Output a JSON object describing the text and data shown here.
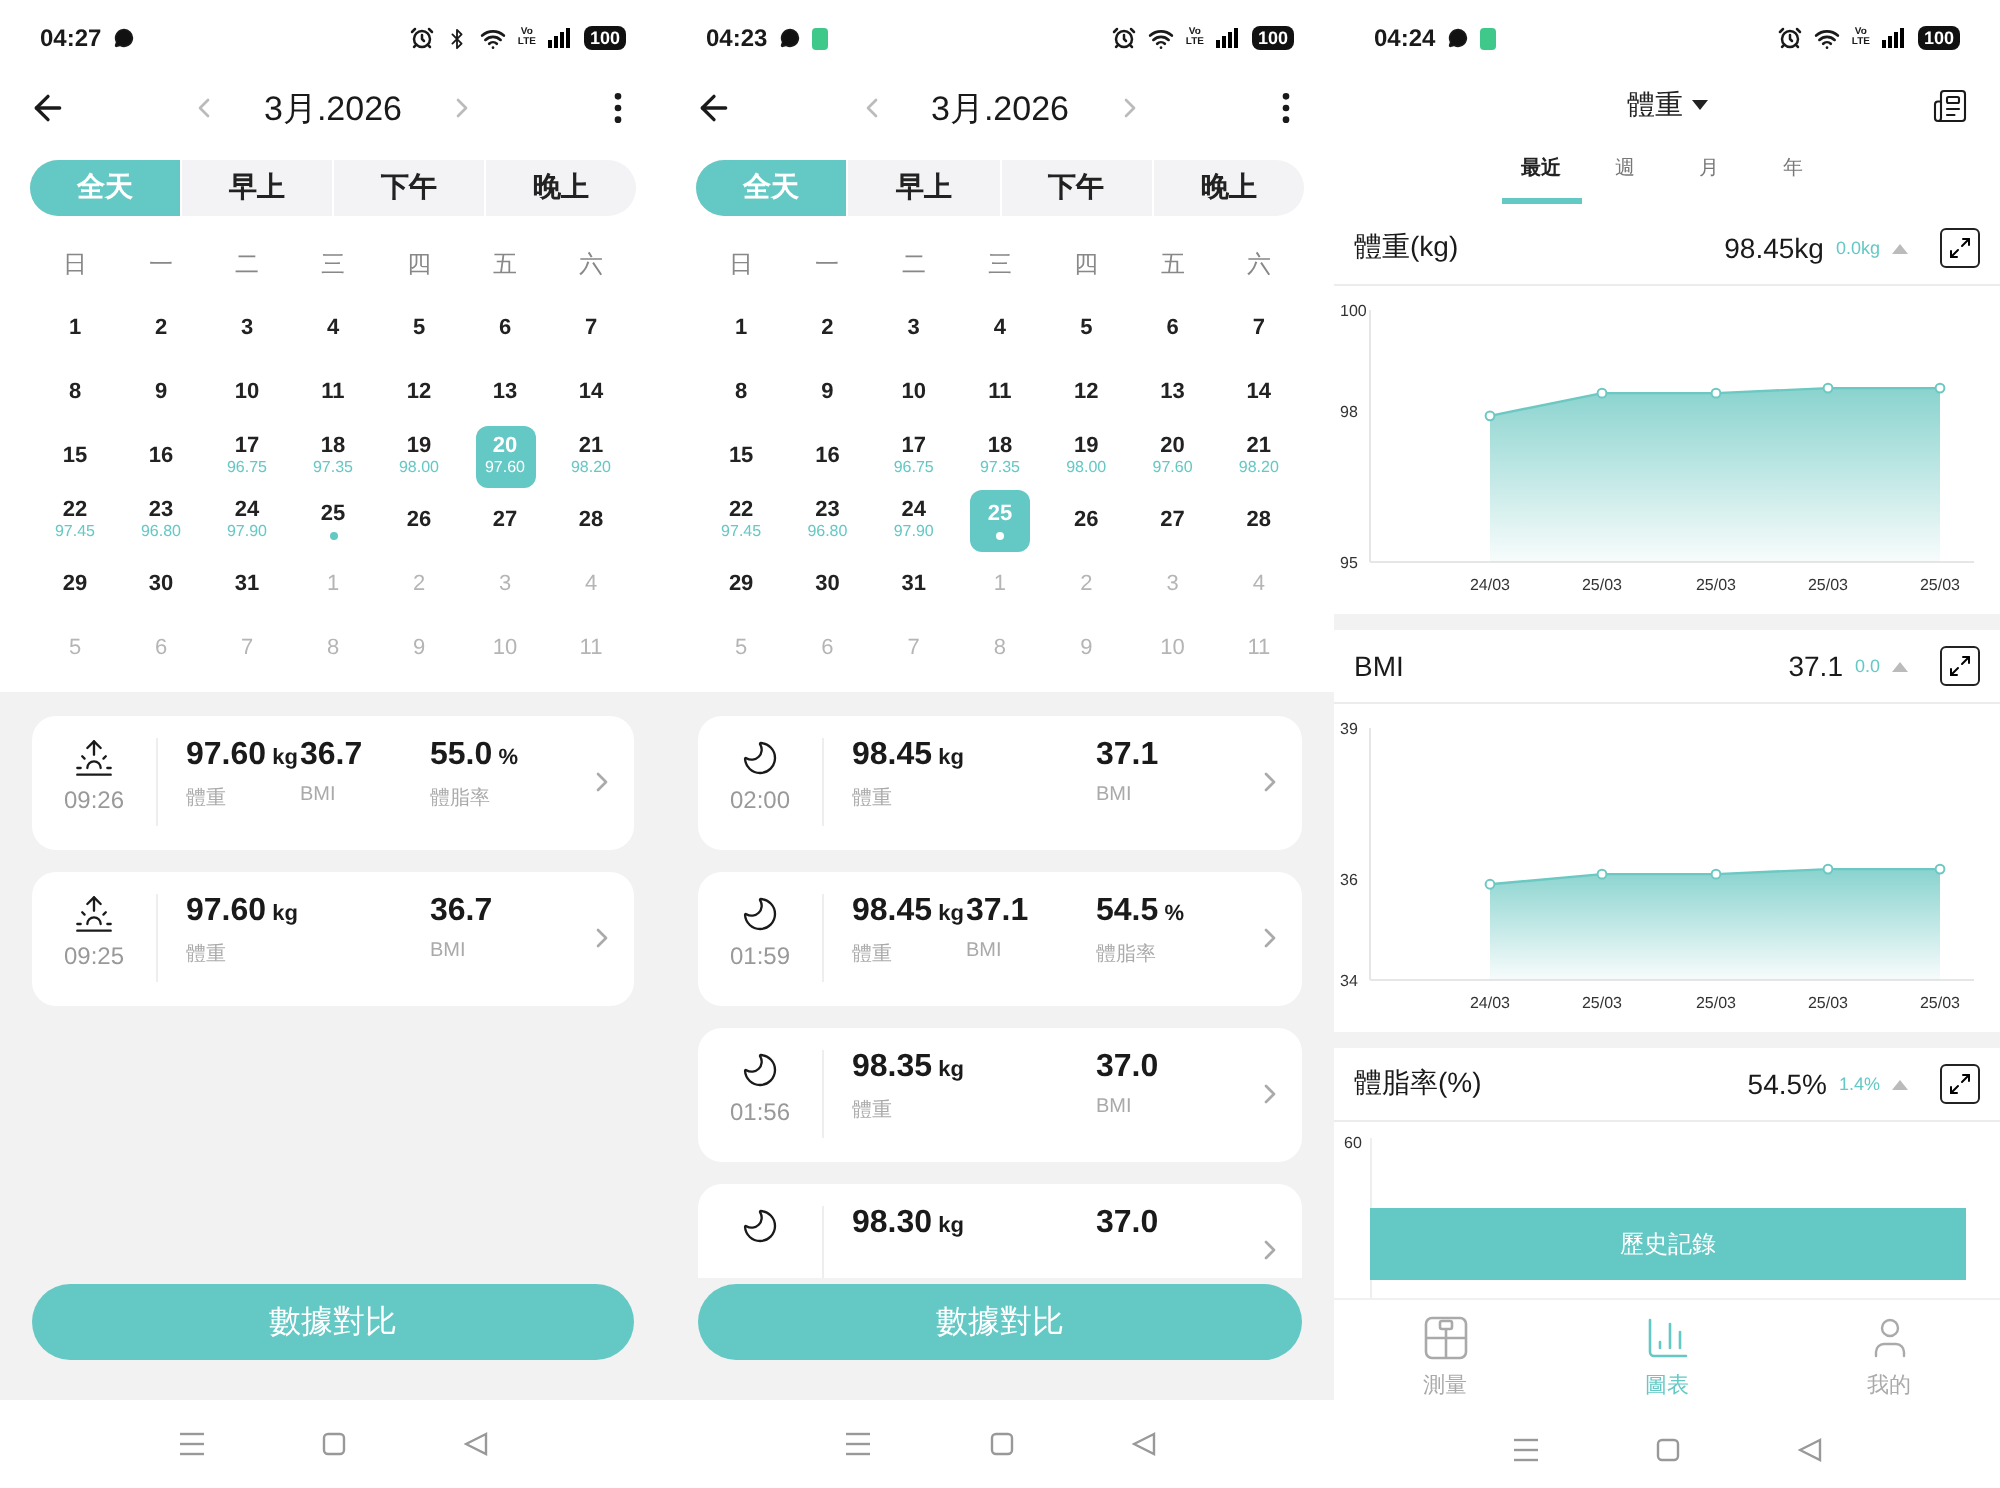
{
  "screens": [
    {
      "kind": "calendar",
      "status_bar": {
        "time": "04:27",
        "battery": "100",
        "left_icons": [
          {
            "kind": "chat"
          }
        ],
        "right_icons": [
          {
            "kind": "alarm"
          },
          {
            "kind": "bluetooth"
          },
          {
            "kind": "wifi"
          }
        ],
        "network": [
          "Vo",
          "LTE"
        ]
      },
      "month": "3月.2026",
      "segments": [
        {
          "label": "全天",
          "selected": true
        },
        {
          "label": "早上",
          "selected": false
        },
        {
          "label": "下午",
          "selected": false
        },
        {
          "label": "晚上",
          "selected": false
        }
      ],
      "weekdays": [
        "日",
        "一",
        "二",
        "三",
        "四",
        "五",
        "六"
      ],
      "weeks": [
        [
          {
            "day": "1",
            "muted": false,
            "selected": false,
            "dot": false
          },
          {
            "day": "2",
            "muted": false,
            "selected": false,
            "dot": false
          },
          {
            "day": "3",
            "muted": false,
            "selected": false,
            "dot": false
          },
          {
            "day": "4",
            "muted": false,
            "selected": false,
            "dot": false
          },
          {
            "day": "5",
            "muted": false,
            "selected": false,
            "dot": false
          },
          {
            "day": "6",
            "muted": false,
            "selected": false,
            "dot": false
          },
          {
            "day": "7",
            "muted": false,
            "selected": false,
            "dot": false
          }
        ],
        [
          {
            "day": "8",
            "muted": false,
            "selected": false,
            "dot": false
          },
          {
            "day": "9",
            "muted": false,
            "selected": false,
            "dot": false
          },
          {
            "day": "10",
            "muted": false,
            "selected": false,
            "dot": false
          },
          {
            "day": "11",
            "muted": false,
            "selected": false,
            "dot": false
          },
          {
            "day": "12",
            "muted": false,
            "selected": false,
            "dot": false
          },
          {
            "day": "13",
            "muted": false,
            "selected": false,
            "dot": false
          },
          {
            "day": "14",
            "muted": false,
            "selected": false,
            "dot": false
          }
        ],
        [
          {
            "day": "15",
            "muted": false,
            "selected": false,
            "dot": false
          },
          {
            "day": "16",
            "muted": false,
            "selected": false,
            "dot": false
          },
          {
            "day": "17",
            "reading": "96.75",
            "muted": false,
            "selected": false,
            "dot": false
          },
          {
            "day": "18",
            "reading": "97.35",
            "muted": false,
            "selected": false,
            "dot": false
          },
          {
            "day": "19",
            "reading": "98.00",
            "muted": false,
            "selected": false,
            "dot": false
          },
          {
            "day": "20",
            "reading": "97.60",
            "muted": false,
            "selected": true,
            "dot": false
          },
          {
            "day": "21",
            "reading": "98.20",
            "muted": false,
            "selected": false,
            "dot": false
          }
        ],
        [
          {
            "day": "22",
            "reading": "97.45",
            "muted": false,
            "selected": false,
            "dot": false
          },
          {
            "day": "23",
            "reading": "96.80",
            "muted": false,
            "selected": false,
            "dot": false
          },
          {
            "day": "24",
            "reading": "97.90",
            "muted": false,
            "selected": false,
            "dot": false
          },
          {
            "day": "25",
            "muted": false,
            "selected": false,
            "dot": true
          },
          {
            "day": "26",
            "muted": false,
            "selected": false,
            "dot": false
          },
          {
            "day": "27",
            "muted": false,
            "selected": false,
            "dot": false
          },
          {
            "day": "28",
            "muted": false,
            "selected": false,
            "dot": false
          }
        ],
        [
          {
            "day": "29",
            "muted": false,
            "selected": false,
            "dot": false
          },
          {
            "day": "30",
            "muted": false,
            "selected": false,
            "dot": false
          },
          {
            "day": "31",
            "muted": false,
            "selected": false,
            "dot": false
          },
          {
            "day": "1",
            "muted": true,
            "selected": false,
            "dot": false
          },
          {
            "day": "2",
            "muted": true,
            "selected": false,
            "dot": false
          },
          {
            "day": "3",
            "muted": true,
            "selected": false,
            "dot": false
          },
          {
            "day": "4",
            "muted": true,
            "selected": false,
            "dot": false
          }
        ],
        [
          {
            "day": "5",
            "muted": true,
            "selected": false,
            "dot": false
          },
          {
            "day": "6",
            "muted": true,
            "selected": false,
            "dot": false
          },
          {
            "day": "7",
            "muted": true,
            "selected": false,
            "dot": false
          },
          {
            "day": "8",
            "muted": true,
            "selected": false,
            "dot": false
          },
          {
            "day": "9",
            "muted": true,
            "selected": false,
            "dot": false
          },
          {
            "day": "10",
            "muted": true,
            "selected": false,
            "dot": false
          },
          {
            "day": "11",
            "muted": true,
            "selected": false,
            "dot": false
          }
        ]
      ],
      "records": [
        {
          "kind": "sun",
          "time": "09:26",
          "metrics": [
            {
              "value": "97.60",
              "unit": "kg",
              "label": "體重"
            },
            {
              "value": "36.7",
              "label": "BMI"
            },
            {
              "value": "55.0",
              "unit": "%",
              "label": "體脂率"
            }
          ]
        },
        {
          "kind": "sun",
          "time": "09:25",
          "metrics": [
            {
              "value": "97.60",
              "unit": "kg",
              "label": "體重"
            },
            {
              "value": "36.7",
              "label": "BMI"
            }
          ]
        }
      ],
      "button": "數據對比"
    },
    {
      "kind": "calendar",
      "status_bar": {
        "time": "04:23",
        "battery": "100",
        "left_icons": [
          {
            "kind": "chat"
          },
          {
            "kind": "battery-app"
          }
        ],
        "right_icons": [
          {
            "kind": "alarm"
          },
          {
            "kind": "wifi"
          }
        ],
        "network": [
          "Vo",
          "LTE"
        ]
      },
      "month": "3月.2026",
      "segments": [
        {
          "label": "全天",
          "selected": true
        },
        {
          "label": "早上",
          "selected": false
        },
        {
          "label": "下午",
          "selected": false
        },
        {
          "label": "晚上",
          "selected": false
        }
      ],
      "weekdays": [
        "日",
        "一",
        "二",
        "三",
        "四",
        "五",
        "六"
      ],
      "weeks": [
        [
          {
            "day": "1",
            "muted": false,
            "selected": false,
            "dot": false
          },
          {
            "day": "2",
            "muted": false,
            "selected": false,
            "dot": false
          },
          {
            "day": "3",
            "muted": false,
            "selected": false,
            "dot": false
          },
          {
            "day": "4",
            "muted": false,
            "selected": false,
            "dot": false
          },
          {
            "day": "5",
            "muted": false,
            "selected": false,
            "dot": false
          },
          {
            "day": "6",
            "muted": false,
            "selected": false,
            "dot": false
          },
          {
            "day": "7",
            "muted": false,
            "selected": false,
            "dot": false
          }
        ],
        [
          {
            "day": "8",
            "muted": false,
            "selected": false,
            "dot": false
          },
          {
            "day": "9",
            "muted": false,
            "selected": false,
            "dot": false
          },
          {
            "day": "10",
            "muted": false,
            "selected": false,
            "dot": false
          },
          {
            "day": "11",
            "muted": false,
            "selected": false,
            "dot": false
          },
          {
            "day": "12",
            "muted": false,
            "selected": false,
            "dot": false
          },
          {
            "day": "13",
            "muted": false,
            "selected": false,
            "dot": false
          },
          {
            "day": "14",
            "muted": false,
            "selected": false,
            "dot": false
          }
        ],
        [
          {
            "day": "15",
            "muted": false,
            "selected": false,
            "dot": false
          },
          {
            "day": "16",
            "muted": false,
            "selected": false,
            "dot": false
          },
          {
            "day": "17",
            "reading": "96.75",
            "muted": false,
            "selected": false,
            "dot": false
          },
          {
            "day": "18",
            "reading": "97.35",
            "muted": false,
            "selected": false,
            "dot": false
          },
          {
            "day": "19",
            "reading": "98.00",
            "muted": false,
            "selected": false,
            "dot": false
          },
          {
            "day": "20",
            "reading": "97.60",
            "muted": false,
            "selected": false,
            "dot": false
          },
          {
            "day": "21",
            "reading": "98.20",
            "muted": false,
            "selected": false,
            "dot": false
          }
        ],
        [
          {
            "day": "22",
            "reading": "97.45",
            "muted": false,
            "selected": false,
            "dot": false
          },
          {
            "day": "23",
            "reading": "96.80",
            "muted": false,
            "selected": false,
            "dot": false
          },
          {
            "day": "24",
            "reading": "97.90",
            "muted": false,
            "selected": false,
            "dot": false
          },
          {
            "day": "25",
            "muted": false,
            "selected": true,
            "dot": true
          },
          {
            "day": "26",
            "muted": false,
            "selected": false,
            "dot": false
          },
          {
            "day": "27",
            "muted": false,
            "selected": false,
            "dot": false
          },
          {
            "day": "28",
            "muted": false,
            "selected": false,
            "dot": false
          }
        ],
        [
          {
            "day": "29",
            "muted": false,
            "selected": false,
            "dot": false
          },
          {
            "day": "30",
            "muted": false,
            "selected": false,
            "dot": false
          },
          {
            "day": "31",
            "muted": false,
            "selected": false,
            "dot": false
          },
          {
            "day": "1",
            "muted": true,
            "selected": false,
            "dot": false
          },
          {
            "day": "2",
            "muted": true,
            "selected": false,
            "dot": false
          },
          {
            "day": "3",
            "muted": true,
            "selected": false,
            "dot": false
          },
          {
            "day": "4",
            "muted": true,
            "selected": false,
            "dot": false
          }
        ],
        [
          {
            "day": "5",
            "muted": true,
            "selected": false,
            "dot": false
          },
          {
            "day": "6",
            "muted": true,
            "selected": false,
            "dot": false
          },
          {
            "day": "7",
            "muted": true,
            "selected": false,
            "dot": false
          },
          {
            "day": "8",
            "muted": true,
            "selected": false,
            "dot": false
          },
          {
            "day": "9",
            "muted": true,
            "selected": false,
            "dot": false
          },
          {
            "day": "10",
            "muted": true,
            "selected": false,
            "dot": false
          },
          {
            "day": "11",
            "muted": true,
            "selected": false,
            "dot": false
          }
        ]
      ],
      "records": [
        {
          "kind": "moon",
          "time": "02:00",
          "metrics": [
            {
              "value": "98.45",
              "unit": "kg",
              "label": "體重"
            },
            {
              "value": "37.1",
              "label": "BMI"
            }
          ]
        },
        {
          "kind": "moon",
          "time": "01:59",
          "metrics": [
            {
              "value": "98.45",
              "unit": "kg",
              "label": "體重"
            },
            {
              "value": "37.1",
              "label": "BMI"
            },
            {
              "value": "54.5",
              "unit": "%",
              "label": "體脂率"
            }
          ]
        },
        {
          "kind": "moon",
          "time": "01:56",
          "metrics": [
            {
              "value": "98.35",
              "unit": "kg",
              "label": "體重"
            },
            {
              "value": "37.0",
              "label": "BMI"
            }
          ]
        },
        {
          "kind": "moon",
          "metrics": [
            {
              "value": "98.30",
              "unit": "kg"
            },
            {
              "value": "37.0"
            }
          ]
        }
      ],
      "button": "數據對比"
    },
    {
      "kind": "charts",
      "status_bar": {
        "time": "04:24",
        "battery": "100",
        "left_icons": [
          {
            "kind": "chat"
          },
          {
            "kind": "battery-app"
          }
        ],
        "right_icons": [
          {
            "kind": "alarm"
          },
          {
            "kind": "wifi"
          }
        ],
        "network": [
          "Vo",
          "LTE"
        ]
      },
      "title": "體重",
      "tabs": [
        {
          "label": "最近",
          "selected": true
        },
        {
          "label": "週",
          "selected": false
        },
        {
          "label": "月",
          "selected": false
        },
        {
          "label": "年",
          "selected": false
        }
      ],
      "cards": [
        {
          "kind": "chart",
          "title": "體重(kg)",
          "value": "98.45kg",
          "change": "0.0kg",
          "chart_data": {
            "type": "area",
            "categories": [
              "24/03",
              "25/03",
              "25/03",
              "25/03",
              "25/03"
            ],
            "ylim": [
              95,
              100
            ],
            "yticks": [
              95,
              98,
              100
            ],
            "series": [
              {
                "color": "#6cc8c2",
                "values": [
                  97.9,
                  98.35,
                  98.35,
                  98.45,
                  98.45
                ]
              }
            ]
          }
        },
        {
          "kind": "chart",
          "title": "BMI",
          "value": "37.1",
          "change": "0.0",
          "chart_data": {
            "type": "area",
            "categories": [
              "24/03",
              "25/03",
              "25/03",
              "25/03",
              "25/03"
            ],
            "ylim": [
              34,
              39
            ],
            "yticks": [
              34,
              36,
              39
            ],
            "series": [
              {
                "color": "#6cc8c2",
                "values": [
                  35.9,
                  36.1,
                  36.1,
                  36.2,
                  36.2
                ]
              }
            ]
          }
        },
        {
          "kind": "stub",
          "title": "體脂率(%)",
          "value": "54.5%",
          "change": "1.4%",
          "top_tick": "60",
          "button": "歷史記錄"
        }
      ],
      "bottom_tabs": [
        {
          "kind": "scale",
          "label": "測量",
          "selected": false
        },
        {
          "kind": "chart",
          "label": "圖表",
          "selected": true
        },
        {
          "kind": "person",
          "label": "我的",
          "selected": false
        }
      ]
    }
  ]
}
